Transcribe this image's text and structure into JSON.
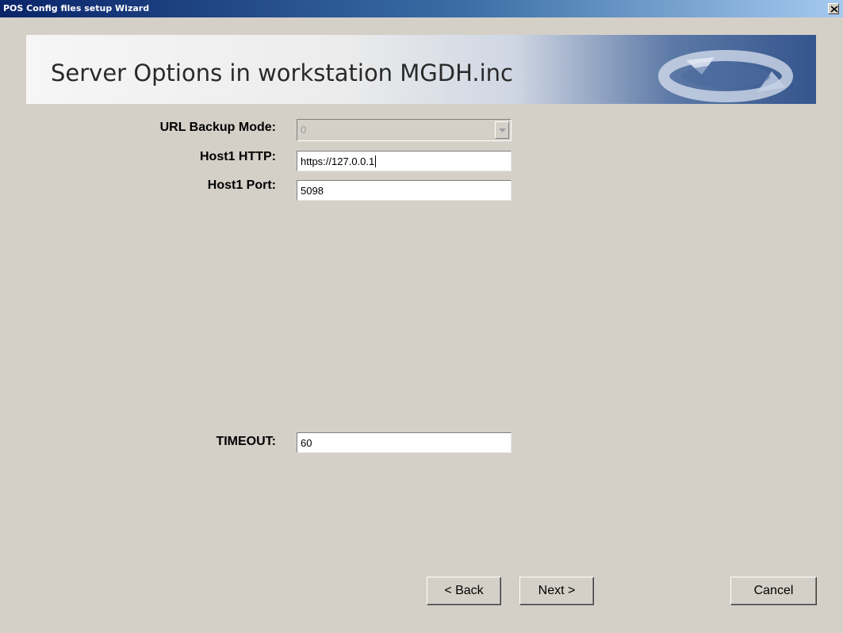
{
  "window": {
    "title": "POS Config files setup Wizard"
  },
  "banner": {
    "title": "Server Options in workstation MGDH.inc"
  },
  "form": {
    "url_backup_mode": {
      "label": "URL Backup Mode:",
      "value": "0"
    },
    "host1_http": {
      "label": "Host1 HTTP:",
      "value": "https://127.0.0.1"
    },
    "host1_port": {
      "label": "Host1 Port:",
      "value": "5098"
    },
    "timeout": {
      "label": "TIMEOUT:",
      "value": "60"
    }
  },
  "buttons": {
    "back": "< Back",
    "next": "Next >",
    "cancel": "Cancel"
  },
  "icons": {
    "close": "close-icon",
    "dropdown": "chevron-down-icon",
    "banner_logo": "refresh-arrows-icon"
  },
  "colors": {
    "window_bg": "#d4d0c8",
    "titlebar_start": "#0a246a",
    "banner_accent": "#34558d"
  }
}
